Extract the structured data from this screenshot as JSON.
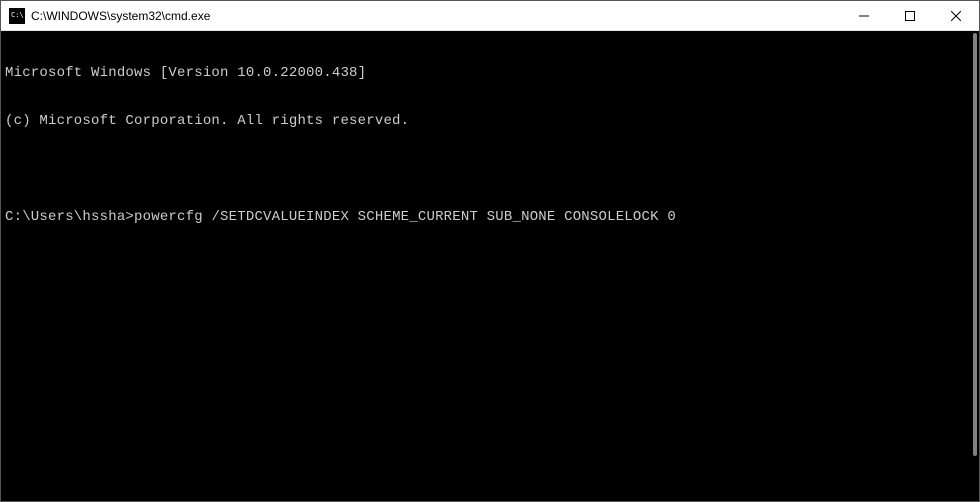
{
  "titlebar": {
    "title": "C:\\WINDOWS\\system32\\cmd.exe"
  },
  "terminal": {
    "line1": "Microsoft Windows [Version 10.0.22000.438]",
    "line2": "(c) Microsoft Corporation. All rights reserved.",
    "blank": "",
    "prompt": "C:\\Users\\hssha>",
    "command": "powercfg /SETDCVALUEINDEX SCHEME_CURRENT SUB_NONE CONSOLELOCK 0"
  }
}
